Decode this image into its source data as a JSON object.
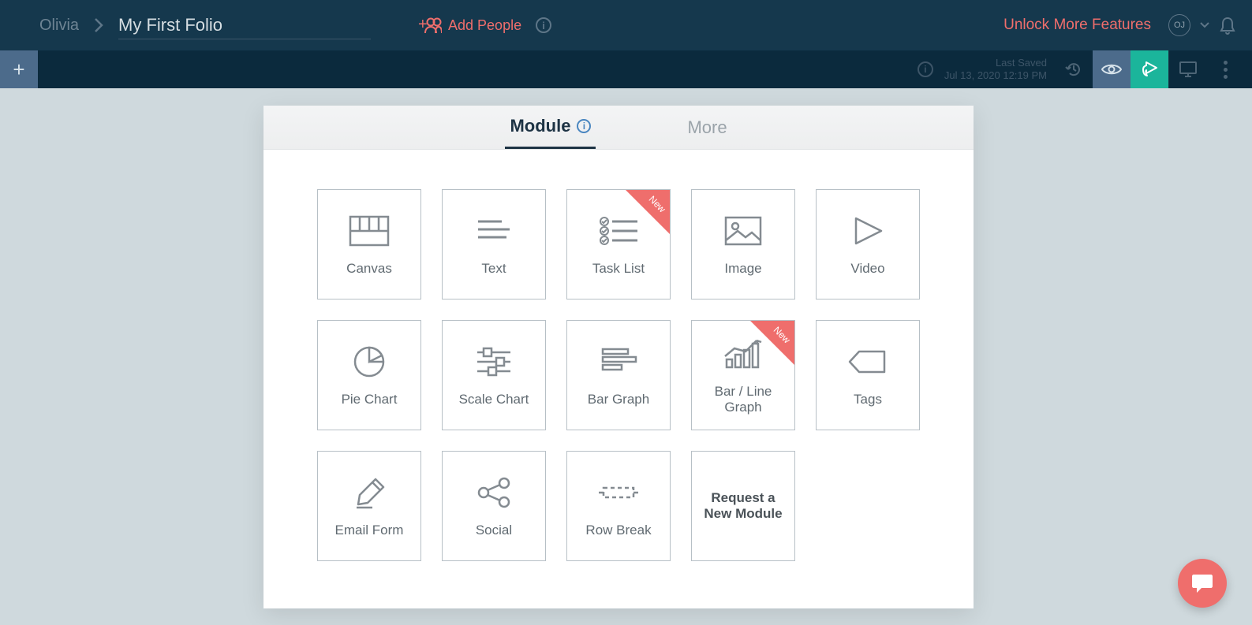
{
  "header": {
    "user": "Olivia",
    "folio_title": "My First Folio",
    "add_people": "Add People",
    "unlock": "Unlock More Features",
    "avatar_initials": "OJ"
  },
  "toolbar": {
    "last_saved_label": "Last Saved",
    "last_saved_time": "Jul 13, 2020 12:19 PM"
  },
  "tabs": {
    "module": "Module",
    "more": "More"
  },
  "badges": {
    "new": "New"
  },
  "modules": [
    {
      "id": "canvas",
      "label": "Canvas",
      "new": false
    },
    {
      "id": "text",
      "label": "Text",
      "new": false
    },
    {
      "id": "tasklist",
      "label": "Task List",
      "new": true
    },
    {
      "id": "image",
      "label": "Image",
      "new": false
    },
    {
      "id": "video",
      "label": "Video",
      "new": false
    },
    {
      "id": "piechart",
      "label": "Pie Chart",
      "new": false
    },
    {
      "id": "scalechart",
      "label": "Scale Chart",
      "new": false
    },
    {
      "id": "bargraph",
      "label": "Bar Graph",
      "new": false
    },
    {
      "id": "barline",
      "label": "Bar / Line Graph",
      "new": true
    },
    {
      "id": "tags",
      "label": "Tags",
      "new": false
    },
    {
      "id": "emailform",
      "label": "Email Form",
      "new": false
    },
    {
      "id": "social",
      "label": "Social",
      "new": false
    },
    {
      "id": "rowbreak",
      "label": "Row Break",
      "new": false
    },
    {
      "id": "request",
      "label": "Request a New Module",
      "new": false
    }
  ]
}
